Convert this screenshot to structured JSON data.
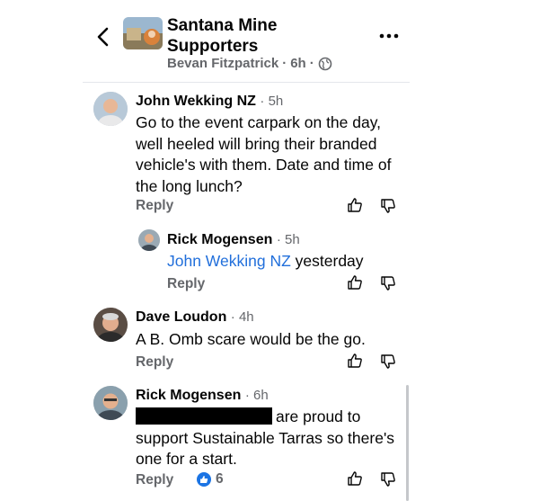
{
  "header": {
    "group_name": "Santana Mine Supporters",
    "poster": "Bevan Fitzpatrick",
    "time": "6h",
    "separator": "·"
  },
  "comments": [
    {
      "author": "John Wekking NZ",
      "time": "5h",
      "text": "Go to the event carpark on the day, well heeled will bring their branded vehicle's with them. Date and time of the long lunch?",
      "reply_label": "Reply"
    },
    {
      "author": "Rick Mogensen",
      "time": "5h",
      "mention": "John Wekking NZ",
      "text": "yesterday",
      "reply_label": "Reply"
    },
    {
      "author": "Dave Loudon",
      "time": "4h",
      "text": "A B. Omb scare would be the go.",
      "reply_label": "Reply"
    },
    {
      "author": "Rick Mogensen",
      "time": "6h",
      "text_after_redaction": "are proud to",
      "text_rest": "support Sustainable Tarras so there's one for a start.",
      "reply_label": "Reply",
      "like_count": "6"
    }
  ],
  "colors": {
    "text": "#050505",
    "secondary": "#65676b",
    "link": "#216fdb",
    "like_blue": "#1b74e4"
  }
}
